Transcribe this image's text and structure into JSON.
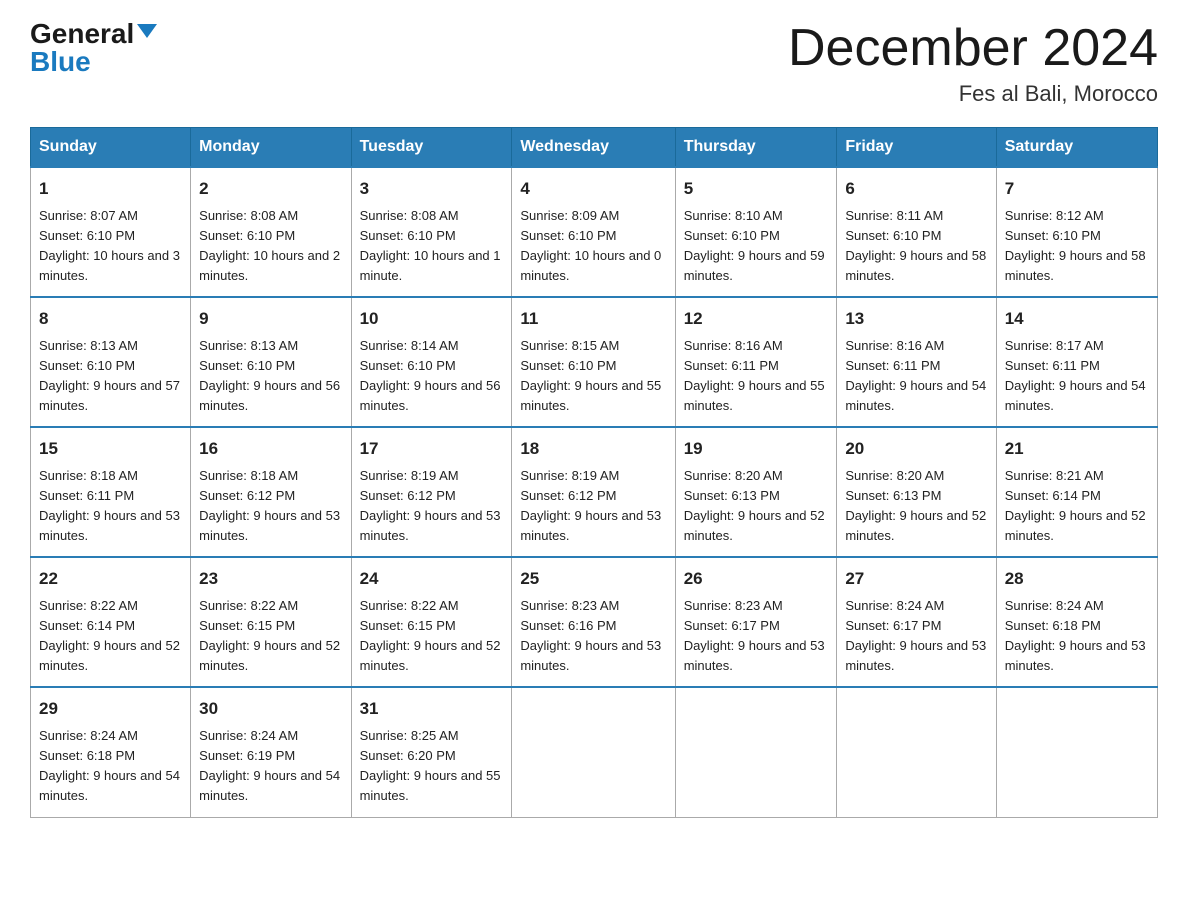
{
  "header": {
    "logo_general": "General",
    "logo_blue": "Blue",
    "title": "December 2024",
    "location": "Fes al Bali, Morocco"
  },
  "weekdays": [
    "Sunday",
    "Monday",
    "Tuesday",
    "Wednesday",
    "Thursday",
    "Friday",
    "Saturday"
  ],
  "weeks": [
    [
      {
        "day": "1",
        "sunrise": "Sunrise: 8:07 AM",
        "sunset": "Sunset: 6:10 PM",
        "daylight": "Daylight: 10 hours and 3 minutes."
      },
      {
        "day": "2",
        "sunrise": "Sunrise: 8:08 AM",
        "sunset": "Sunset: 6:10 PM",
        "daylight": "Daylight: 10 hours and 2 minutes."
      },
      {
        "day": "3",
        "sunrise": "Sunrise: 8:08 AM",
        "sunset": "Sunset: 6:10 PM",
        "daylight": "Daylight: 10 hours and 1 minute."
      },
      {
        "day": "4",
        "sunrise": "Sunrise: 8:09 AM",
        "sunset": "Sunset: 6:10 PM",
        "daylight": "Daylight: 10 hours and 0 minutes."
      },
      {
        "day": "5",
        "sunrise": "Sunrise: 8:10 AM",
        "sunset": "Sunset: 6:10 PM",
        "daylight": "Daylight: 9 hours and 59 minutes."
      },
      {
        "day": "6",
        "sunrise": "Sunrise: 8:11 AM",
        "sunset": "Sunset: 6:10 PM",
        "daylight": "Daylight: 9 hours and 58 minutes."
      },
      {
        "day": "7",
        "sunrise": "Sunrise: 8:12 AM",
        "sunset": "Sunset: 6:10 PM",
        "daylight": "Daylight: 9 hours and 58 minutes."
      }
    ],
    [
      {
        "day": "8",
        "sunrise": "Sunrise: 8:13 AM",
        "sunset": "Sunset: 6:10 PM",
        "daylight": "Daylight: 9 hours and 57 minutes."
      },
      {
        "day": "9",
        "sunrise": "Sunrise: 8:13 AM",
        "sunset": "Sunset: 6:10 PM",
        "daylight": "Daylight: 9 hours and 56 minutes."
      },
      {
        "day": "10",
        "sunrise": "Sunrise: 8:14 AM",
        "sunset": "Sunset: 6:10 PM",
        "daylight": "Daylight: 9 hours and 56 minutes."
      },
      {
        "day": "11",
        "sunrise": "Sunrise: 8:15 AM",
        "sunset": "Sunset: 6:10 PM",
        "daylight": "Daylight: 9 hours and 55 minutes."
      },
      {
        "day": "12",
        "sunrise": "Sunrise: 8:16 AM",
        "sunset": "Sunset: 6:11 PM",
        "daylight": "Daylight: 9 hours and 55 minutes."
      },
      {
        "day": "13",
        "sunrise": "Sunrise: 8:16 AM",
        "sunset": "Sunset: 6:11 PM",
        "daylight": "Daylight: 9 hours and 54 minutes."
      },
      {
        "day": "14",
        "sunrise": "Sunrise: 8:17 AM",
        "sunset": "Sunset: 6:11 PM",
        "daylight": "Daylight: 9 hours and 54 minutes."
      }
    ],
    [
      {
        "day": "15",
        "sunrise": "Sunrise: 8:18 AM",
        "sunset": "Sunset: 6:11 PM",
        "daylight": "Daylight: 9 hours and 53 minutes."
      },
      {
        "day": "16",
        "sunrise": "Sunrise: 8:18 AM",
        "sunset": "Sunset: 6:12 PM",
        "daylight": "Daylight: 9 hours and 53 minutes."
      },
      {
        "day": "17",
        "sunrise": "Sunrise: 8:19 AM",
        "sunset": "Sunset: 6:12 PM",
        "daylight": "Daylight: 9 hours and 53 minutes."
      },
      {
        "day": "18",
        "sunrise": "Sunrise: 8:19 AM",
        "sunset": "Sunset: 6:12 PM",
        "daylight": "Daylight: 9 hours and 53 minutes."
      },
      {
        "day": "19",
        "sunrise": "Sunrise: 8:20 AM",
        "sunset": "Sunset: 6:13 PM",
        "daylight": "Daylight: 9 hours and 52 minutes."
      },
      {
        "day": "20",
        "sunrise": "Sunrise: 8:20 AM",
        "sunset": "Sunset: 6:13 PM",
        "daylight": "Daylight: 9 hours and 52 minutes."
      },
      {
        "day": "21",
        "sunrise": "Sunrise: 8:21 AM",
        "sunset": "Sunset: 6:14 PM",
        "daylight": "Daylight: 9 hours and 52 minutes."
      }
    ],
    [
      {
        "day": "22",
        "sunrise": "Sunrise: 8:22 AM",
        "sunset": "Sunset: 6:14 PM",
        "daylight": "Daylight: 9 hours and 52 minutes."
      },
      {
        "day": "23",
        "sunrise": "Sunrise: 8:22 AM",
        "sunset": "Sunset: 6:15 PM",
        "daylight": "Daylight: 9 hours and 52 minutes."
      },
      {
        "day": "24",
        "sunrise": "Sunrise: 8:22 AM",
        "sunset": "Sunset: 6:15 PM",
        "daylight": "Daylight: 9 hours and 52 minutes."
      },
      {
        "day": "25",
        "sunrise": "Sunrise: 8:23 AM",
        "sunset": "Sunset: 6:16 PM",
        "daylight": "Daylight: 9 hours and 53 minutes."
      },
      {
        "day": "26",
        "sunrise": "Sunrise: 8:23 AM",
        "sunset": "Sunset: 6:17 PM",
        "daylight": "Daylight: 9 hours and 53 minutes."
      },
      {
        "day": "27",
        "sunrise": "Sunrise: 8:24 AM",
        "sunset": "Sunset: 6:17 PM",
        "daylight": "Daylight: 9 hours and 53 minutes."
      },
      {
        "day": "28",
        "sunrise": "Sunrise: 8:24 AM",
        "sunset": "Sunset: 6:18 PM",
        "daylight": "Daylight: 9 hours and 53 minutes."
      }
    ],
    [
      {
        "day": "29",
        "sunrise": "Sunrise: 8:24 AM",
        "sunset": "Sunset: 6:18 PM",
        "daylight": "Daylight: 9 hours and 54 minutes."
      },
      {
        "day": "30",
        "sunrise": "Sunrise: 8:24 AM",
        "sunset": "Sunset: 6:19 PM",
        "daylight": "Daylight: 9 hours and 54 minutes."
      },
      {
        "day": "31",
        "sunrise": "Sunrise: 8:25 AM",
        "sunset": "Sunset: 6:20 PM",
        "daylight": "Daylight: 9 hours and 55 minutes."
      },
      null,
      null,
      null,
      null
    ]
  ]
}
